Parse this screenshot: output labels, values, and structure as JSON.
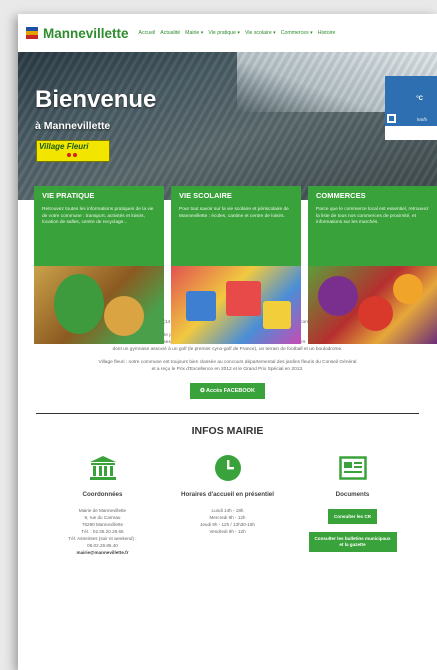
{
  "header": {
    "site_name": "Mannevillette",
    "flag_colors": [
      "#1f4fa0",
      "#e6a000",
      "#c62828"
    ],
    "nav": [
      {
        "label": "Accueil"
      },
      {
        "label": "Actualité"
      },
      {
        "label": "Mairie ▾"
      },
      {
        "label": "Vie pratique ▾"
      },
      {
        "label": "Vie scolaire ▾"
      },
      {
        "label": "Commerces ▾"
      },
      {
        "label": "Histoire"
      }
    ]
  },
  "hero": {
    "title": "Bienvenue",
    "subtitle": "à Mannevillette",
    "badge": "Village Fleuri",
    "weather_unit": "°C",
    "weather_speed": "km/h"
  },
  "cards": [
    {
      "title": "VIE PRATIQUE",
      "text": "Retrouvez toutes les informations pratiques de la vie de votre commune : transport, activités et loisirs, location de salles, centre de recyclage..."
    },
    {
      "title": "VIE SCOLAIRE",
      "text": "Pour tout savoir sur la vie scolaire et périscolaire de Mannevillette : écoles, cantine et centre de loisirs."
    },
    {
      "title": "COMMERCES",
      "text": "Parce que le commerce local est essentiel, retrouvez la liste de tous nos commerces de proximité, et informations sur les marchés."
    }
  ],
  "intro": {
    "p1": "Située à mi-chemin entre Le Havre (18 km) et Etretat (14 km) et à 8 km de Montivilliers, la commune de Mannevillette compte 881 mannevillettais sur ses 420 hectares.",
    "p2a": "Elle propose une école, quinze associations et cinq entreprises.",
    "p2b": "Parmi ses services, Mannevillette offre un cadre pour de nombreux loisirs",
    "p2c": "dont un gymnase associé à un golf (le premier cyno-golf de France), un terrain de football et un boulodrome.",
    "p3a": "Village fleuri : notre commune est toujours bien classée au concours départemental des jardins fleuris du Conseil Général",
    "p3b": "et a reçu le Prix d'Excellence en 2012 et le Grand Prix Spécial en 2013.",
    "fb_button": "Accès FACEBOOK"
  },
  "infos": {
    "title": "INFOS MAIRIE",
    "coordonnees": {
      "title": "Coordonnées",
      "lines": [
        "Mairie de Mannevillette",
        "9, rue du Carreau",
        "76290 Mannevillette",
        "Tél. : 02.35.20.29.65",
        "Tél. Astreintes (soir et weekend) :",
        "06.02.29.85.40",
        "mairie@mannevillette.fr"
      ]
    },
    "horaires": {
      "title": "Horaires d'accueil en présentiel",
      "lines": [
        "Lundi 14h - 18h",
        "Mercredi 9h - 12h",
        "Jeudi 9h - 12h / 13h30-15h",
        "Vendredi 9h - 12h"
      ]
    },
    "documents": {
      "title": "Documents",
      "btn1": "Consulter les CR",
      "btn2": "Consulter les bulletins municipaux et la gazette"
    }
  },
  "colors": {
    "brand_green": "#3aa23a",
    "logo_green": "#2f8c2f"
  }
}
